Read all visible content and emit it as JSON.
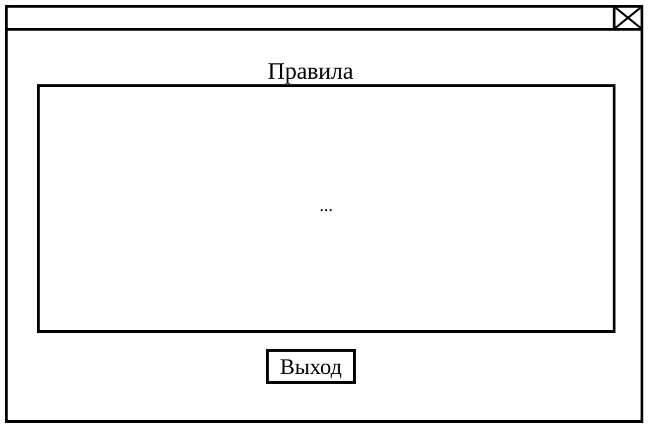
{
  "window": {
    "close_icon": "close-icon"
  },
  "main": {
    "title": "Правила",
    "content": "..."
  },
  "footer": {
    "exit_label": "Выход"
  }
}
